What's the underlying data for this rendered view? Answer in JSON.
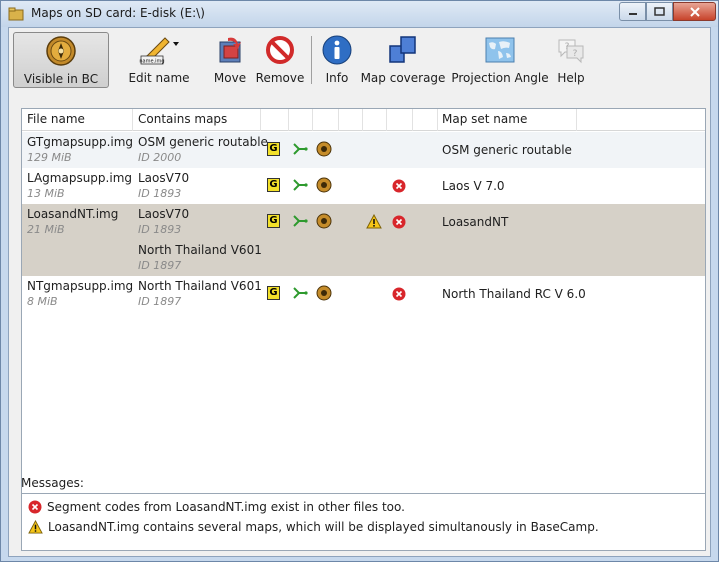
{
  "window": {
    "title": "Maps on SD card: E-disk (E:\\)"
  },
  "toolbar": {
    "visible_in_bc": "Visible in BC",
    "edit_name": "Edit name",
    "edit_name_icon_text": "name.img",
    "move": "Move",
    "remove": "Remove",
    "info": "Info",
    "map_coverage": "Map coverage",
    "projection_angle": "Projection Angle",
    "help": "Help"
  },
  "table": {
    "headers": {
      "file_name": "File name",
      "contains_maps": "Contains maps",
      "map_set_name": "Map set name"
    },
    "rows": [
      {
        "file": "GTgmapsupp.img",
        "size": "129 MiB",
        "maps": [
          {
            "name": "OSM generic routable",
            "id": "ID 2000"
          }
        ],
        "set_name": "OSM generic routable",
        "error": false,
        "warning": false
      },
      {
        "file": "LAgmapsupp.img",
        "size": "13 MiB",
        "maps": [
          {
            "name": "LaosV70",
            "id": "ID 1893"
          }
        ],
        "set_name": "Laos V 7.0",
        "error": true,
        "warning": false
      },
      {
        "file": "LoasandNT.img",
        "size": "21 MiB",
        "maps": [
          {
            "name": "LaosV70",
            "id": "ID 1893"
          },
          {
            "name": "North Thailand V601",
            "id": "ID 1897"
          }
        ],
        "set_name": "LoasandNT",
        "error": true,
        "warning": true
      },
      {
        "file": "NTgmapsupp.img",
        "size": "8 MiB",
        "maps": [
          {
            "name": "North Thailand V601",
            "id": "ID 1897"
          }
        ],
        "set_name": "North Thailand RC V 6.0",
        "error": true,
        "warning": false
      }
    ],
    "g_badge": "G"
  },
  "messages": {
    "label": "Messages:",
    "items": [
      {
        "type": "error",
        "text": "Segment codes from LoasandNT.img exist in other files too."
      },
      {
        "type": "warning",
        "text": "LoasandNT.img contains several maps, which will be displayed simultanously in BaseCamp."
      }
    ]
  },
  "colors": {
    "selected_row": "#d6d1c8",
    "error_red": "#d8262b",
    "warning_yellow": "#f5c518"
  }
}
